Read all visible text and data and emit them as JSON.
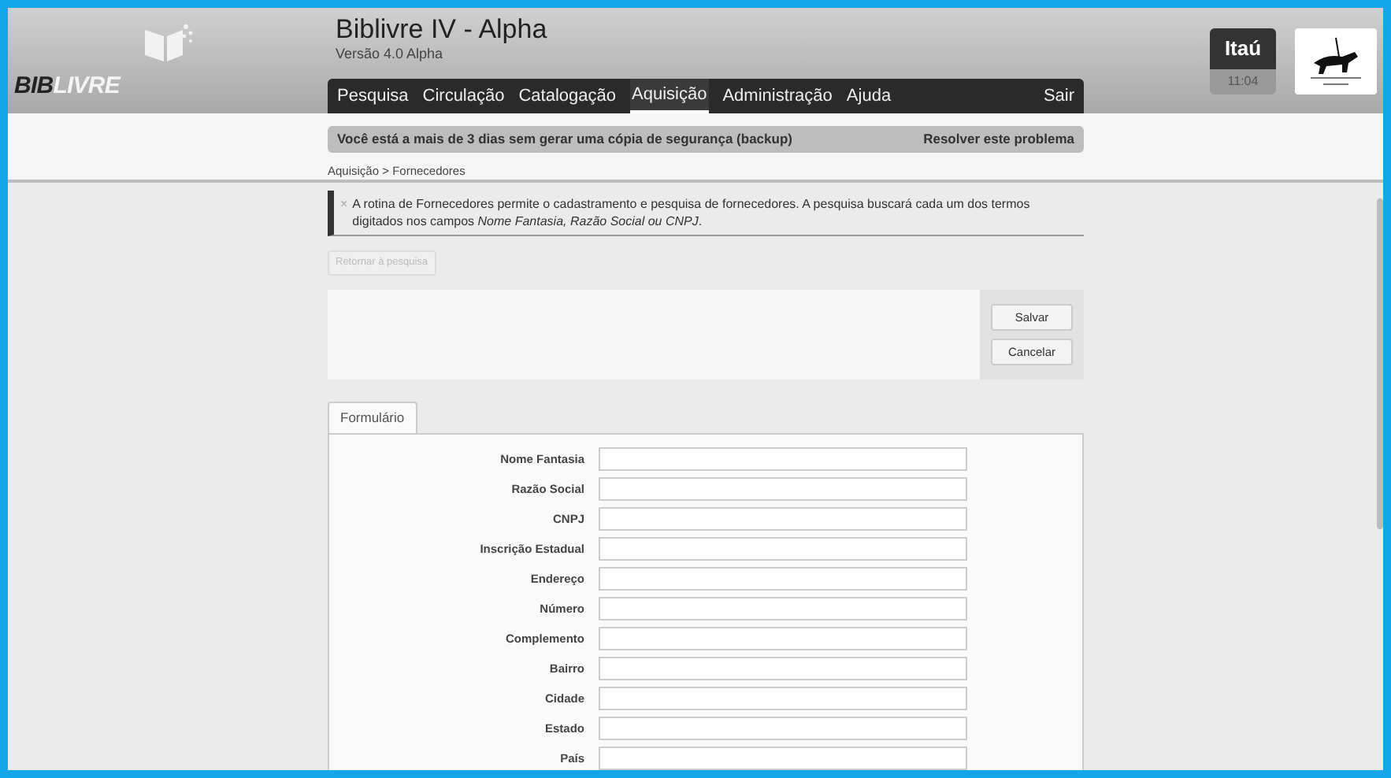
{
  "logo": {
    "part_1": "BIB",
    "part_2": "LIVRE"
  },
  "header": {
    "title": "Biblivre IV - Alpha",
    "subtitle": "Versão 4.0 Alpha"
  },
  "nav": {
    "items": [
      {
        "label": "Pesquisa",
        "selected": false
      },
      {
        "label": "Circulação",
        "selected": false
      },
      {
        "label": "Catalogação",
        "selected": false
      },
      {
        "label": "Aquisição",
        "selected": true
      },
      {
        "label": "Administração",
        "selected": false
      },
      {
        "label": "Ajuda",
        "selected": false
      }
    ],
    "logout": "Sair"
  },
  "clock": {
    "label": "Itaú",
    "time": "11:04"
  },
  "backup_warning": {
    "message": "Você está a mais de 3 dias sem gerar uma cópia de segurança (backup)",
    "action": "Resolver este problema"
  },
  "breadcrumb": "Aquisição > Fornecedores",
  "info": {
    "close": "×",
    "text": "A rotina de Fornecedores permite o cadastramento e pesquisa de fornecedores. A pesquisa buscará cada um dos termos digitados nos campos *Nome Fantasia, Razão Social ou CNPJ*."
  },
  "return_button": {
    "label": "Retornar à pesquisa",
    "disabled": true
  },
  "actions": [
    "Salvar",
    "Cancelar"
  ],
  "tabs": [
    {
      "label": "Formulário",
      "selected": true
    }
  ],
  "form": {
    "fields": [
      {
        "label": "Nome Fantasia"
      },
      {
        "label": "Razão Social"
      },
      {
        "label": "CNPJ"
      },
      {
        "label": "Inscrição Estadual"
      },
      {
        "label": "Endereço"
      },
      {
        "label": "Número"
      },
      {
        "label": "Complemento"
      },
      {
        "label": "Bairro"
      },
      {
        "label": "Cidade"
      },
      {
        "label": "Estado"
      },
      {
        "label": "País"
      }
    ]
  }
}
